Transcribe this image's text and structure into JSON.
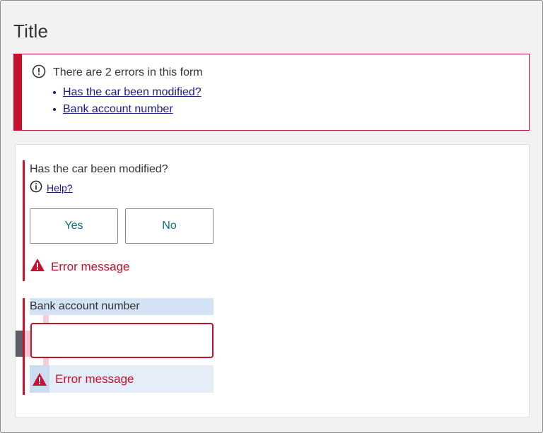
{
  "page": {
    "title": "Title"
  },
  "error_summary": {
    "heading": "There are 2 errors in this form",
    "links": [
      "Has the car been modified?",
      "Bank account number"
    ],
    "accent_color": "#c8102e"
  },
  "question_modified": {
    "label": "Has the car been modified?",
    "help_label": "Help?",
    "options": [
      "Yes",
      "No"
    ],
    "error": "Error message"
  },
  "question_bank": {
    "label": "Bank account number",
    "value": "",
    "error": "Error message"
  },
  "icons": {
    "summary": "alert-circle-icon",
    "help": "info-icon",
    "error": "warning-triangle-icon"
  },
  "colors": {
    "error": "#c8102e",
    "link": "#1a1a8c",
    "choice_text": "#0b6e7a"
  }
}
